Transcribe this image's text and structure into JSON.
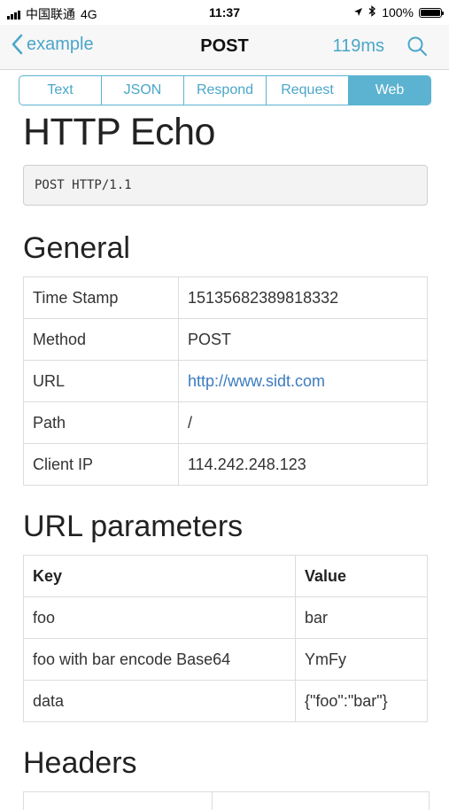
{
  "status_bar": {
    "carrier": "中国联通",
    "network": "4G",
    "time": "11:37",
    "battery": "100%",
    "battery_level": 1.0
  },
  "nav": {
    "back_label": "example",
    "title": "POST",
    "timing": "119ms",
    "accent_color": "#4aa6c9"
  },
  "tabs": [
    {
      "label": "Text",
      "active": false
    },
    {
      "label": "JSON",
      "active": false
    },
    {
      "label": "Respond",
      "active": false
    },
    {
      "label": "Request",
      "active": false
    },
    {
      "label": "Web",
      "active": true
    }
  ],
  "page": {
    "title": "HTTP Echo",
    "request_line": "POST HTTP/1.1"
  },
  "general": {
    "heading": "General",
    "rows": [
      {
        "key": "Time Stamp",
        "value": "15135682389818332"
      },
      {
        "key": "Method",
        "value": "POST"
      },
      {
        "key": "URL",
        "value": "http://www.sidt.com"
      },
      {
        "key": "Path",
        "value": "/"
      },
      {
        "key": "Client IP",
        "value": "114.242.248.123"
      }
    ]
  },
  "url_params": {
    "heading": "URL parameters",
    "col_key": "Key",
    "col_value": "Value",
    "rows": [
      {
        "key": "foo",
        "value": "bar"
      },
      {
        "key": "foo with bar encode Base64",
        "value": "YmFy"
      },
      {
        "key": "data",
        "value": "{\"foo\":\"bar\"}"
      }
    ]
  },
  "headers": {
    "heading": "Headers"
  }
}
